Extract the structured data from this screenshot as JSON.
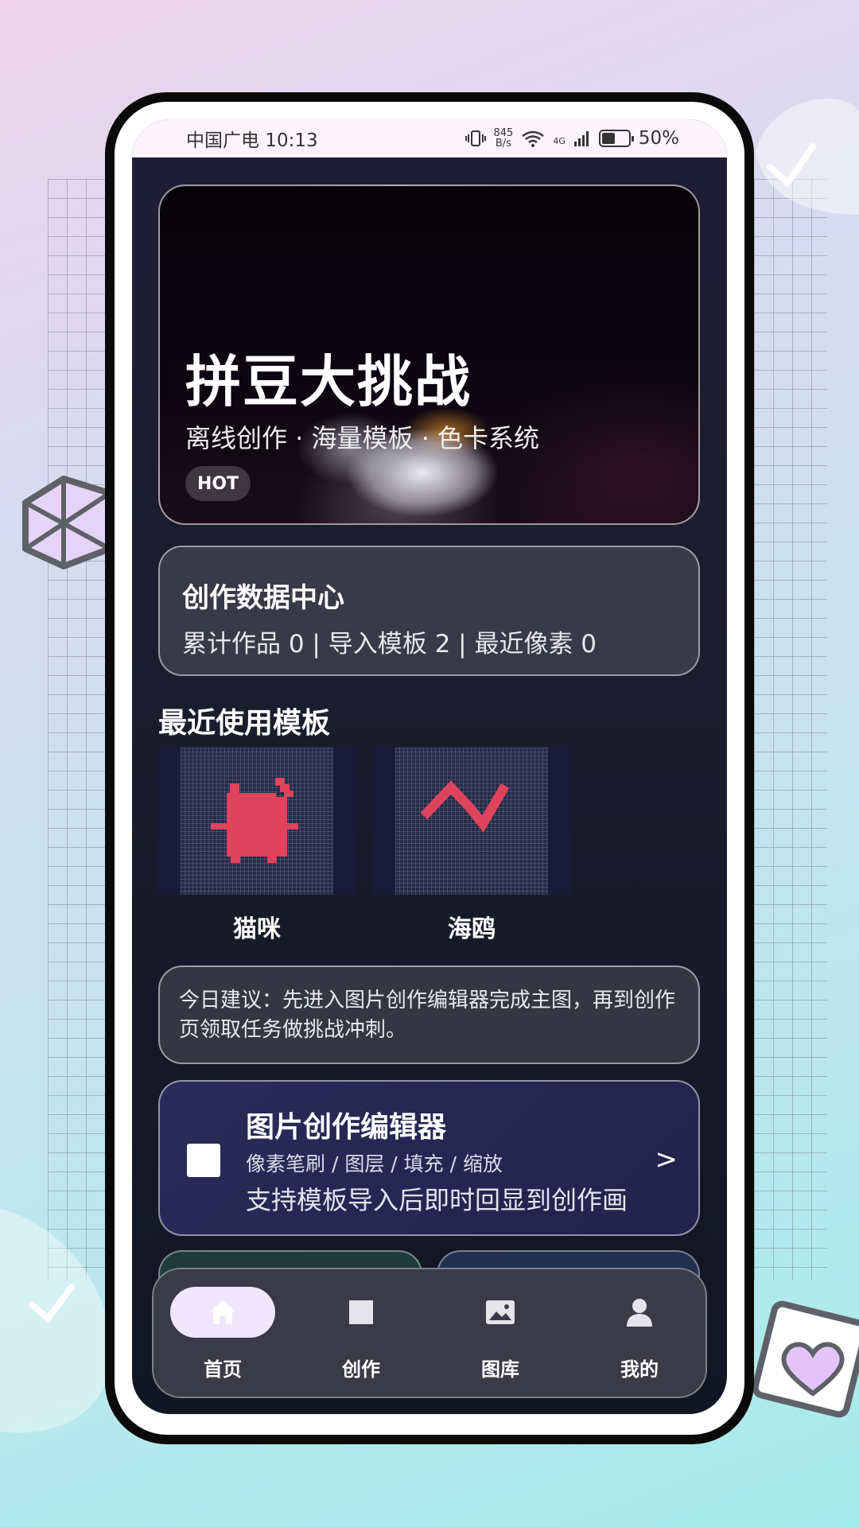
{
  "status_bar": {
    "carrier_time": "中国广电 10:13",
    "net_speed_value": "845",
    "net_speed_unit": "B/s",
    "net_type": "4G",
    "battery": "50%"
  },
  "hero": {
    "title": "拼豆大挑战",
    "subtitle": "离线创作 · 海量模板 · 色卡系统",
    "badge": "HOT"
  },
  "data_center": {
    "title": "创作数据中心",
    "stats": "累计作品 0 | 导入模板 2 | 最近像素 0"
  },
  "recent_templates": {
    "title": "最近使用模板",
    "items": [
      {
        "name": "猫咪",
        "icon": "cat-pixel-art"
      },
      {
        "name": "海鸥",
        "icon": "seagull-pixel-art"
      }
    ]
  },
  "tip": {
    "text": "今日建议：先进入图片创作编辑器完成主图，再到创作页领取任务做挑战冲刺。"
  },
  "editor_card": {
    "title": "图片创作编辑器",
    "tags": "像素笔刷 / 图层 / 填充 / 缩放",
    "description": "支持模板导入后即时回显到创作画",
    "arrow": ">"
  },
  "tab_bar": {
    "items": [
      {
        "label": "首页",
        "icon": "home-icon",
        "active": true
      },
      {
        "label": "创作",
        "icon": "square-icon",
        "active": false
      },
      {
        "label": "图库",
        "icon": "image-icon",
        "active": false
      },
      {
        "label": "我的",
        "icon": "user-icon",
        "active": false
      }
    ]
  },
  "colors": {
    "pixel_art": "#e0445c",
    "tab_active_bg": "#efe6fb",
    "screen_bg": "#1b1c2d"
  }
}
